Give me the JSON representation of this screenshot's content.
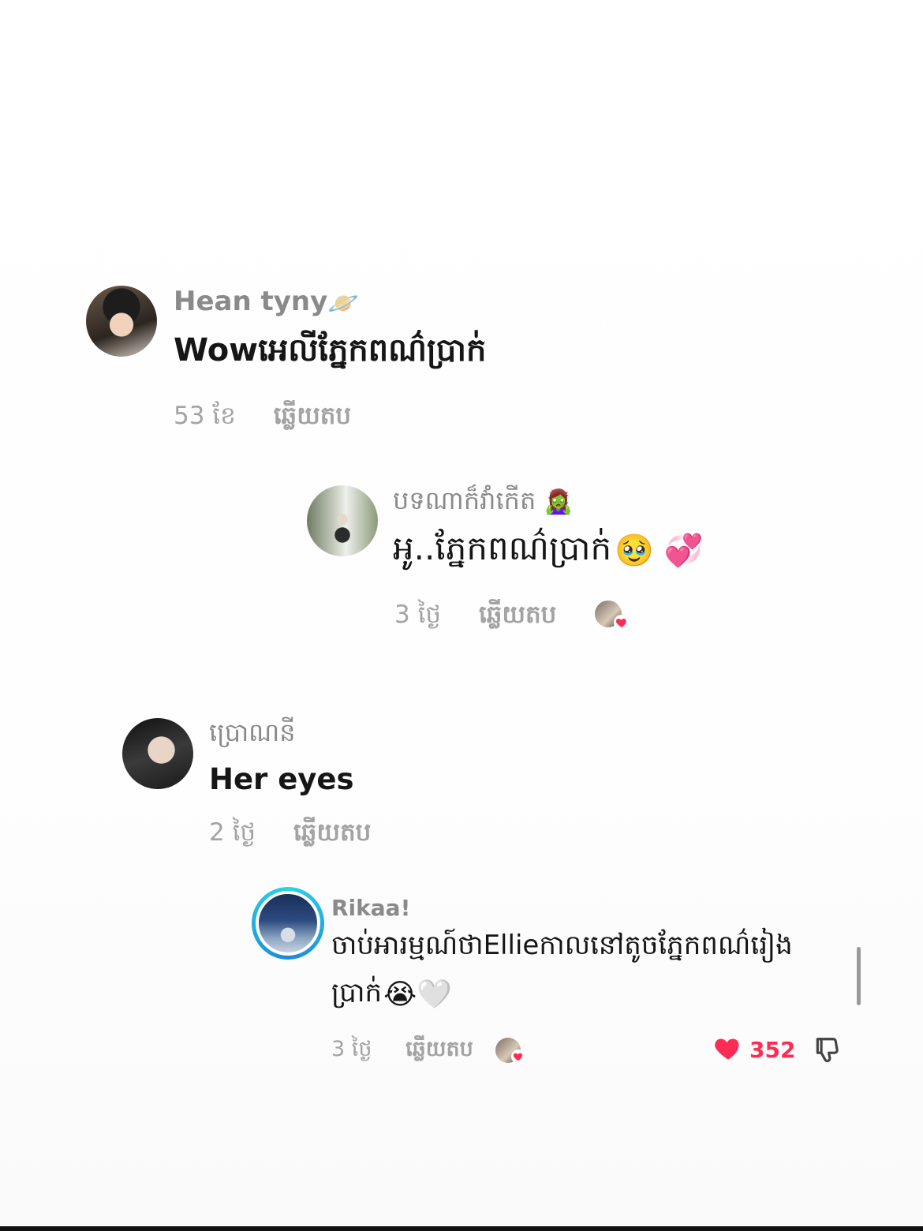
{
  "comments": [
    {
      "username": "Hean tyny",
      "username_emoji": "🪐",
      "text": "Wowអេលីភ្នែកពណ៌ប្រាក់",
      "time": "53 ខែ",
      "reply_label": "ឆ្លើយតប"
    },
    {
      "username": "បទណាក៏វាំកើត",
      "username_emoji": "🧟‍♀️",
      "text": "អូ..ភ្នែកពណ៌ប្រាក់",
      "text_emojis": "🥹 💞",
      "time": "3 ថ្ងៃ",
      "reply_label": "ឆ្លើយតប"
    },
    {
      "username": "ប្រោណនី",
      "text": "Her eyes",
      "time": "2 ថ្ងៃ",
      "reply_label": "ឆ្លើយតប"
    },
    {
      "username": "Rikaa!",
      "text_line1": "ចាប់អារម្មណ៍ថាEllieកាលនៅតូចភ្នែកពណ៌រៀង",
      "text_line2": "ប្រាក់",
      "text_emojis": "😭🤍",
      "time": "3 ថ្ងៃ",
      "reply_label": "ឆ្លើយតប",
      "like_count": "352"
    }
  ],
  "colors": {
    "like_red": "#fe2c55",
    "meta_gray": "#a3a3a3",
    "username_gray": "#8a8a8a",
    "text_dark": "#161616"
  },
  "icons": {
    "like": "heart-filled-icon",
    "dislike": "thumbs-down-icon",
    "creator_liked": "creator-liked-heart-icon"
  }
}
